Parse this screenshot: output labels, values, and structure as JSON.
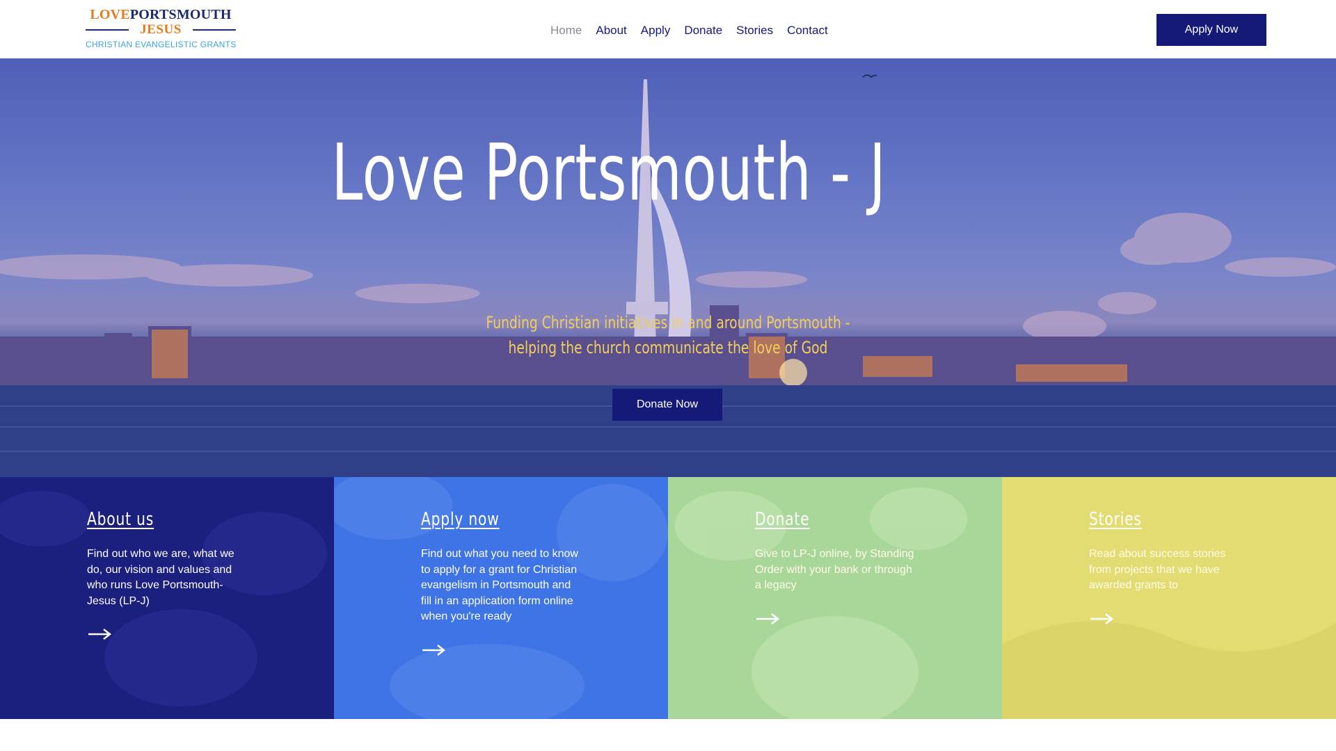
{
  "header": {
    "logo": {
      "line1_love": "LOVE",
      "line1_portsmouth": "PORTSMOUTH",
      "line2": "JESUS",
      "line3": "CHRISTIAN EVANGELISTIC GRANTS"
    },
    "nav": [
      {
        "label": "Home",
        "active": true
      },
      {
        "label": "About",
        "active": false
      },
      {
        "label": "Apply",
        "active": false
      },
      {
        "label": "Donate",
        "active": false
      },
      {
        "label": "Stories",
        "active": false
      },
      {
        "label": "Contact",
        "active": false
      }
    ],
    "apply_button": "Apply Now"
  },
  "hero": {
    "title": "Love Portsmouth - J",
    "subtitle_line1": "Funding Christian initiatives in and around Portsmouth -",
    "subtitle_line2": "helping the church communicate the love of God",
    "donate_button": "Donate Now"
  },
  "panels": [
    {
      "title": "About us",
      "text": "Find out who we are, what we do, our vision and values and who runs Love Portsmouth-Jesus (LP-J)",
      "arrow_icon": "arrow-right-icon"
    },
    {
      "title": "Apply now",
      "text": "Find out what you need to know to apply for a grant for Christian evangelism in Portsmouth and fill in an application form online when you're ready",
      "arrow_icon": "arrow-right-icon"
    },
    {
      "title": "Donate",
      "text": "Give to LP-J online, by Standing Order with your bank or through a legacy",
      "arrow_icon": "arrow-right-icon"
    },
    {
      "title": "Stories",
      "text": "Read about success stories from projects that we have awarded grants to",
      "arrow_icon": "arrow-right-icon"
    }
  ],
  "colors": {
    "brand_navy": "#151a78",
    "brand_orange": "#e87a1e",
    "subtitle_gold": "#f1cf5a",
    "panel_about": "#1b1f7e",
    "panel_apply": "#3f74e6",
    "panel_donate": "#a9d79a",
    "panel_stories": "#e3dc72"
  }
}
